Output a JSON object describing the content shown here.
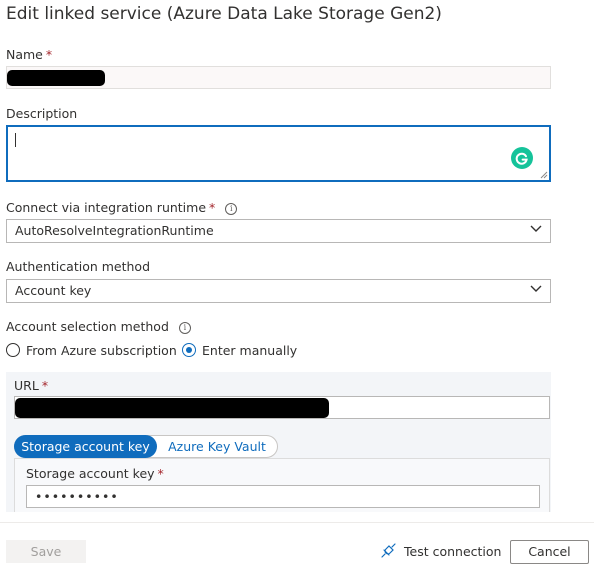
{
  "dialog": {
    "title": "Edit linked service (Azure Data Lake Storage Gen2)"
  },
  "form": {
    "name_label": "Name",
    "required_mark": "*",
    "description_label": "Description",
    "runtime_label": "Connect via integration runtime",
    "runtime_value": "AutoResolveIntegrationRuntime",
    "auth_label": "Authentication method",
    "auth_value": "Account key",
    "account_selection_label": "Account selection method",
    "options": {
      "from_subscription": "From Azure subscription",
      "enter_manually": "Enter manually"
    },
    "url_label": "URL",
    "key_tabs": {
      "storage_key": "Storage account key",
      "key_vault": "Azure Key Vault"
    },
    "storage_key_label": "Storage account key",
    "storage_key_value": "••••••••••",
    "info_glyph": "i"
  },
  "footer": {
    "save_label": "Save",
    "test_label": "Test connection",
    "cancel_label": "Cancel"
  },
  "colors": {
    "accent": "#0f6cbd",
    "grammarly": "#15c39a",
    "required": "#a4262c"
  }
}
